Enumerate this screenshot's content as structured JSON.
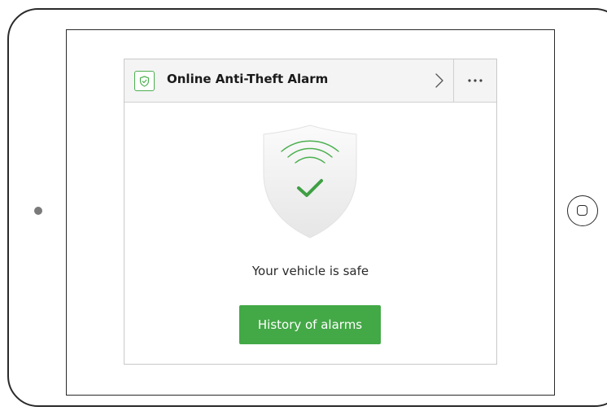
{
  "card": {
    "title": "Online Anti-Theft Alarm",
    "status": "Your vehicle is safe",
    "history_button_label": "History of alarms"
  },
  "icons": {
    "header_badge": "shield-check-icon",
    "navigate": "chevron-right-icon",
    "more": "more-horizontal-icon",
    "status_shield": "shield-signal-check-icon"
  },
  "colors": {
    "accent_green": "#43a846",
    "header_background": "#f4f4f4",
    "text_dark": "#1a1a1a"
  }
}
